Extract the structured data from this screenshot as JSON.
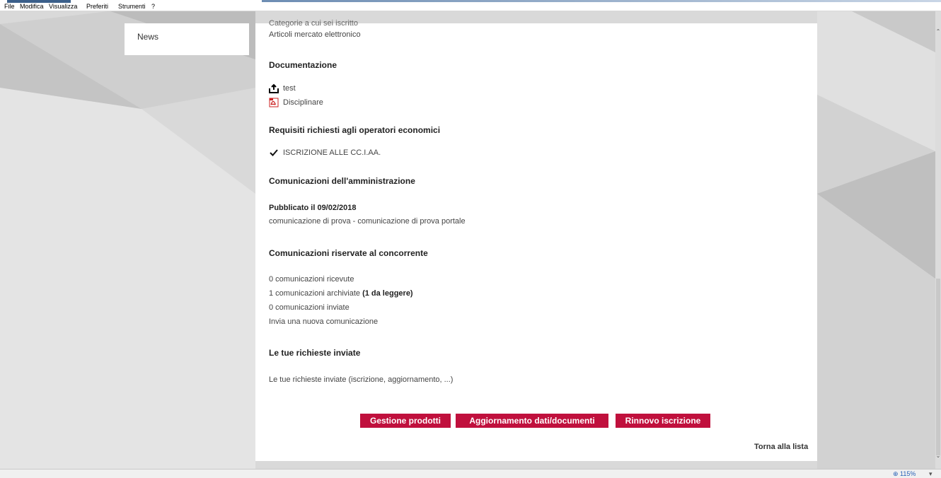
{
  "menu": {
    "items": [
      "File",
      "Modifica",
      "Visualizza",
      "Preferiti",
      "Strumenti",
      "?"
    ]
  },
  "sidebar": {
    "news_label": "News"
  },
  "main": {
    "cut_off_text": "Categorie a cui sei iscritto",
    "articles_link": "Articoli mercato elettronico",
    "documentazione": {
      "heading": "Documentazione",
      "items": [
        {
          "label": "test",
          "icon": "upload-icon"
        },
        {
          "label": "Disciplinare",
          "icon": "pdf-icon"
        }
      ]
    },
    "requisiti": {
      "heading": "Requisiti richiesti agli operatori economici",
      "items": [
        {
          "label": "ISCRIZIONE ALLE CC.I.AA.",
          "icon": "check-icon"
        }
      ]
    },
    "comunicazioni_amm": {
      "heading": "Comunicazioni dell'amministrazione",
      "published": "Pubblicato il 09/02/2018",
      "text": "comunicazione di prova - comunicazione di prova portale"
    },
    "comunicazioni_ris": {
      "heading": "Comunicazioni riservate al concorrente",
      "received": "0 comunicazioni ricevute",
      "archived": "1 comunicazioni archiviate",
      "archived_unread": "(1 da leggere)",
      "sent": "0 comunicazioni inviate",
      "new_link": "Invia una nuova comunicazione"
    },
    "richieste": {
      "heading": "Le tue richieste inviate",
      "text": "Le tue richieste inviate (iscrizione, aggiornamento, ...)"
    },
    "buttons": {
      "gestione": "Gestione prodotti",
      "aggiornamento": "Aggiornamento dati/documenti",
      "rinnovo": "Rinnovo iscrizione"
    },
    "back_link": "Torna alla lista"
  },
  "status": {
    "zoom": "115%"
  },
  "colors": {
    "accent": "#c0103d"
  }
}
